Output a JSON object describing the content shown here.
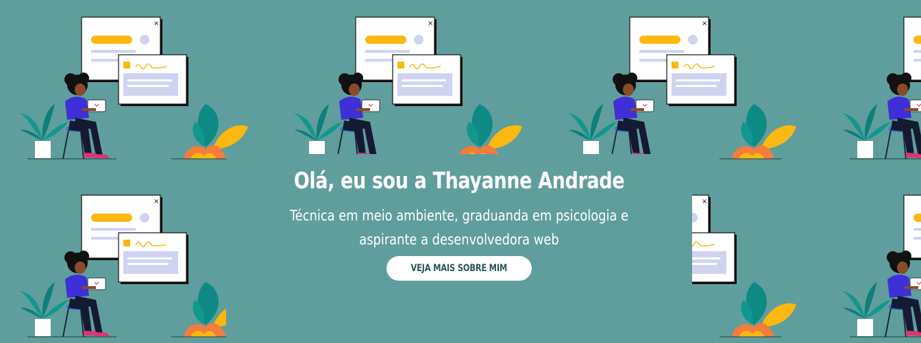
{
  "hero": {
    "title": "Olá, eu sou a Thayanne Andrade",
    "subtitle": "Técnica em meio ambiente, graduanda em psicologia e aspirante a desenvolvedora web",
    "cta_label": "VEJA MAIS SOBRE MIM",
    "background_color": "#5f9e9c",
    "illustration": "woman-with-laptop-pattern"
  },
  "colors": {
    "accent_yellow": "#fbb810",
    "shirt_purple": "#3f2fd8",
    "leaf_teal": "#12978f",
    "leaf_orange": "#f47c3c",
    "card_lavender": "#cfd3f0",
    "button_text": "#2c5857"
  }
}
